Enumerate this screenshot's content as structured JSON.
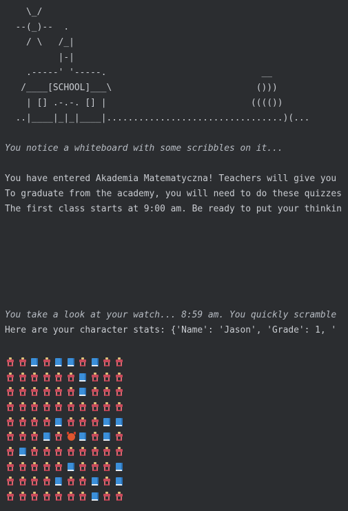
{
  "ascii_art": {
    "lines": [
      "    \\_/",
      "  --(_)--  .",
      "    / \\   /_|",
      "          |-|",
      "    .-----' '-----.                             __",
      "   /____[SCHOOL]___\\                           ()))",
      "    | [] .-.-. [] |                           (((())",
      "  ..|____|_|_|____|.................................)(..."
    ]
  },
  "messages": {
    "whiteboard": "You notice a whiteboard with some scribbles on it...",
    "welcome_1": "You have entered Akademia Matematyczna! Teachers will give you",
    "welcome_2": "To graduate from the academy, you will need to do these quizzes",
    "welcome_3": "The first class starts at 9:00 am. Be ready to put your thinkin",
    "watch": "You take a look at your watch... 8:59 am. You quickly scramble",
    "stats": "Here are your character stats: {'Name': 'Jason', 'Grade': 1, '"
  },
  "grid": {
    "legend": {
      "d": "desk-icon",
      "b": "book-icon",
      "x": "devil-icon"
    },
    "rows": [
      "ddbdbbdbdd",
      "ddddddbddd",
      "ddddddbddd",
      "dddddddddd",
      "ddddbdddbb",
      "dddbdxbdbd",
      "dbdddddddd",
      "dddddbdddb",
      "ddddbddbdb",
      "dddddddbdd"
    ]
  }
}
